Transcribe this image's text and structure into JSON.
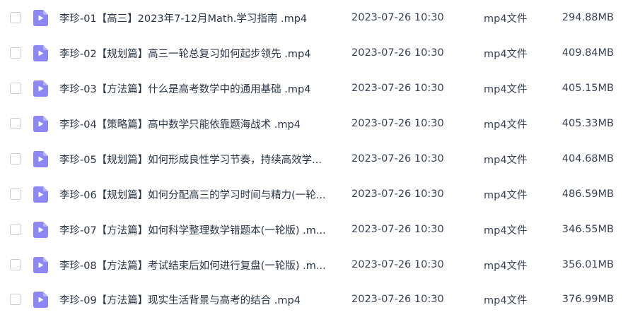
{
  "colors": {
    "icon_fill": "#8c87f5",
    "icon_fold": "#b8b4fa",
    "text": "#2a3446"
  },
  "files": [
    {
      "name": "李珍-01【高三】2023年7-12月Math.学习指南 .mp4",
      "date": "2023-07-26 10:30",
      "type": "mp4文件",
      "size": "294.88MB",
      "icon": "video-file-icon"
    },
    {
      "name": "李珍-02【规划篇】高三一轮总复习如何起步领先 .mp4",
      "date": "2023-07-26 10:30",
      "type": "mp4文件",
      "size": "409.84MB",
      "icon": "video-file-icon"
    },
    {
      "name": "李珍-03【方法篇】什么是高考数学中的通用基础 .mp4",
      "date": "2023-07-26 10:30",
      "type": "mp4文件",
      "size": "405.15MB",
      "icon": "video-file-icon"
    },
    {
      "name": "李珍-04【策略篇】高中数学只能依靠题海战术 .mp4",
      "date": "2023-07-26 10:30",
      "type": "mp4文件",
      "size": "405.33MB",
      "icon": "video-file-icon"
    },
    {
      "name": "李珍-05【规划篇】如何形成良性学习节奏，持续高效学...",
      "date": "2023-07-26 10:30",
      "type": "mp4文件",
      "size": "404.68MB",
      "icon": "video-file-icon"
    },
    {
      "name": "李珍-06【规划篇】如何分配高三的学习时间与精力(一轮...",
      "date": "2023-07-26 10:30",
      "type": "mp4文件",
      "size": "486.59MB",
      "icon": "video-file-icon"
    },
    {
      "name": "李珍-07【方法篇】如何科学整理数学错题本(一轮版) .m...",
      "date": "2023-07-26 10:30",
      "type": "mp4文件",
      "size": "346.55MB",
      "icon": "video-file-icon"
    },
    {
      "name": "李珍-08【方法篇】考试结束后如何进行复盘(一轮版) .m...",
      "date": "2023-07-26 10:30",
      "type": "mp4文件",
      "size": "356.01MB",
      "icon": "video-file-icon"
    },
    {
      "name": "李珍-09【方法篇】现实生活背景与高考的结合 .mp4",
      "date": "2023-07-26 10:30",
      "type": "mp4文件",
      "size": "376.99MB",
      "icon": "video-file-icon"
    }
  ]
}
